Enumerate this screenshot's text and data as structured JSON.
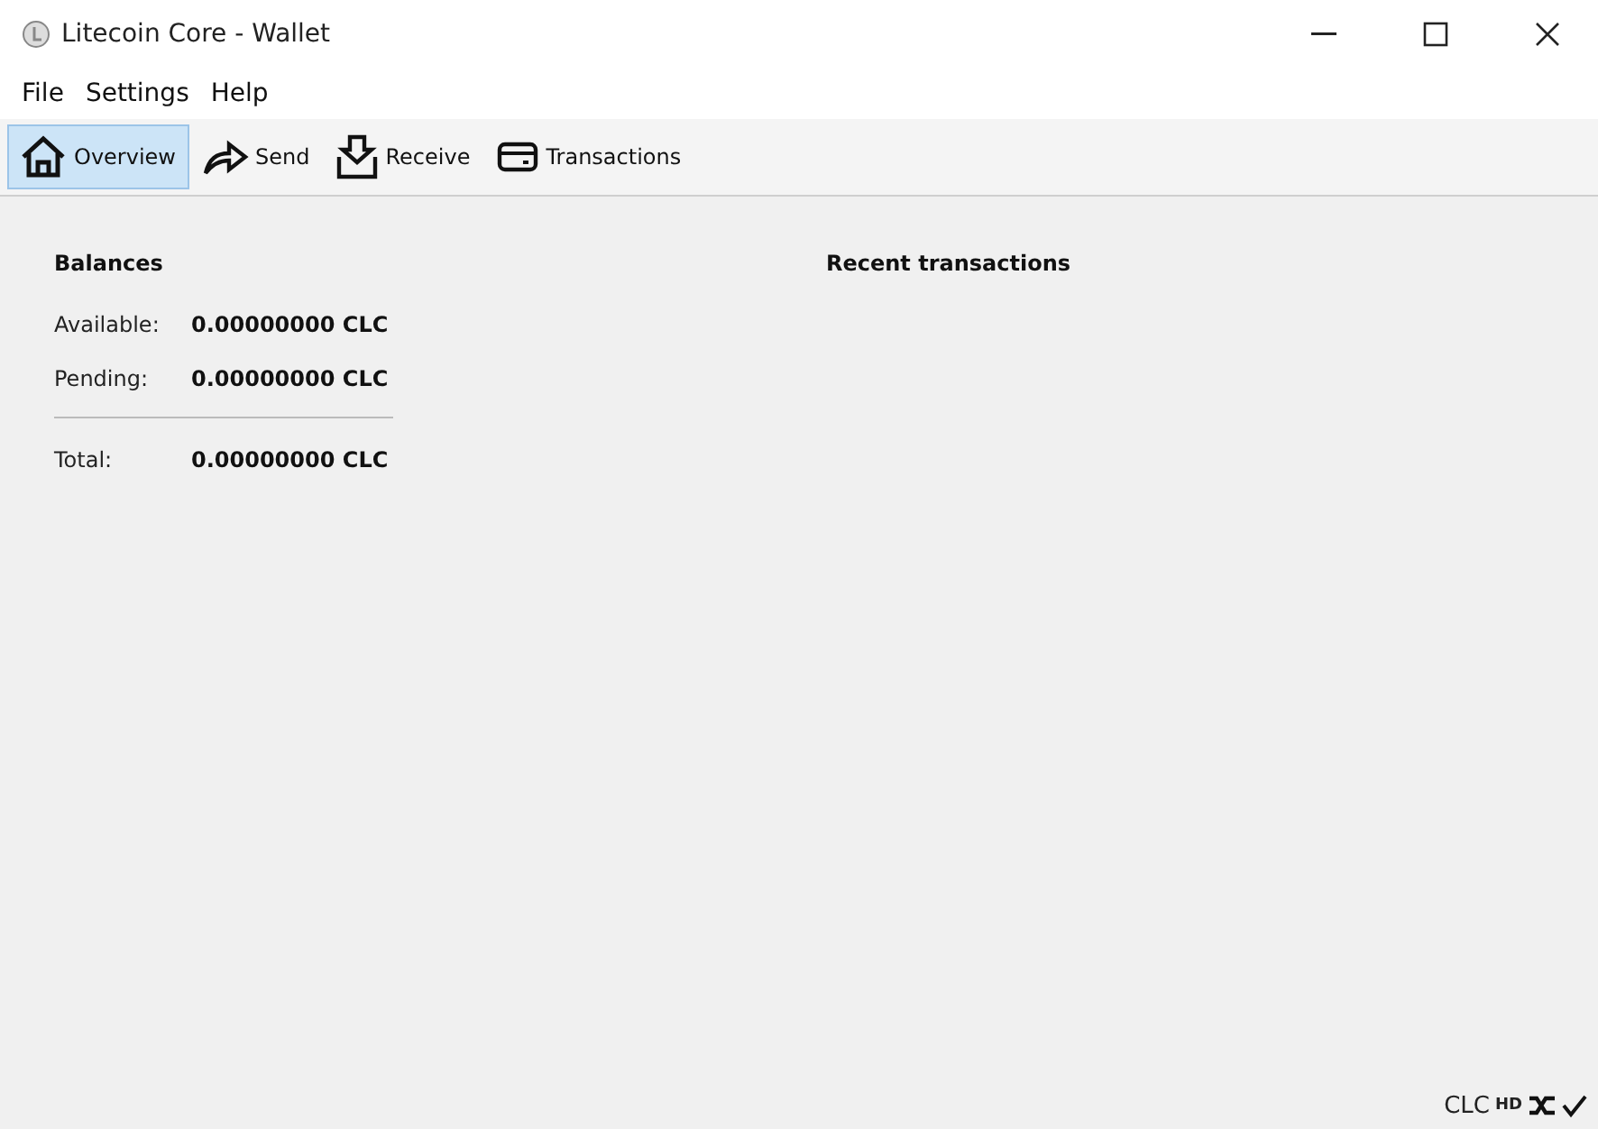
{
  "window": {
    "title": "Litecoin Core - Wallet"
  },
  "menu": [
    "File",
    "Settings",
    "Help"
  ],
  "tabs": [
    {
      "label": "Overview",
      "kind": "home",
      "selected": true
    },
    {
      "label": "Send",
      "kind": "send",
      "selected": false
    },
    {
      "label": "Receive",
      "kind": "receive",
      "selected": false
    },
    {
      "label": "Transactions",
      "kind": "transactions",
      "selected": false
    }
  ],
  "balances": {
    "title": "Balances",
    "rows": [
      {
        "label": "Available:",
        "value": "0.00000000 CLC"
      },
      {
        "label": "Pending:",
        "value": "0.00000000 CLC"
      }
    ],
    "total": {
      "label": "Total:",
      "value": "0.00000000 CLC"
    }
  },
  "recent": {
    "title": "Recent transactions"
  },
  "status_bar": {
    "unit": "CLC",
    "hd": "HD"
  }
}
